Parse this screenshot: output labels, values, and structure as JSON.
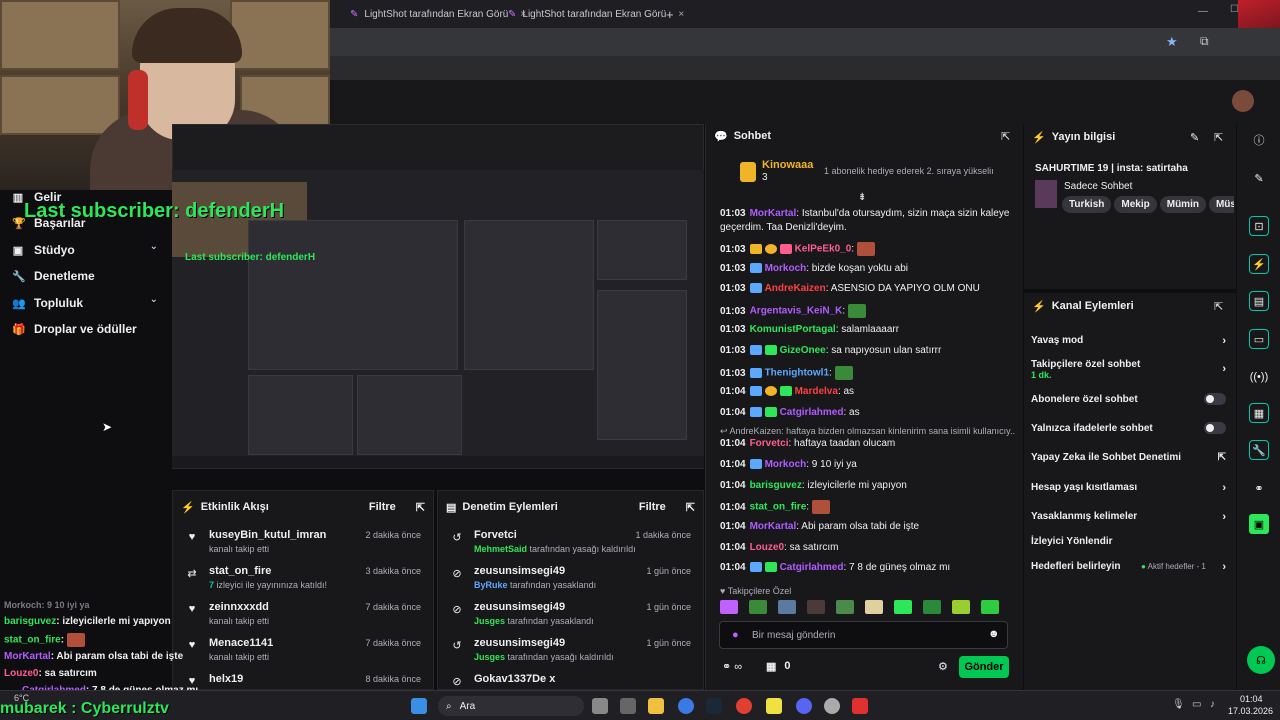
{
  "browser": {
    "tabs": [
      {
        "label": "LightShot tarafından Ekran Görü",
        "close": "×"
      },
      {
        "label": "LightShot tarafından Ekran Görü",
        "close": "×"
      }
    ],
    "new_tab": "+"
  },
  "overlay": {
    "subscriber_text": "Last subscriber: defenderH",
    "mini_subscriber_text": "Last subscriber: defenderH",
    "bottom_text": "mubarek : Cyberrulztv"
  },
  "nav": {
    "items": [
      {
        "label": "Gelir",
        "icon": "bar-chart-icon"
      },
      {
        "label": "Başarılar",
        "icon": "trophy-icon"
      },
      {
        "label": "Stüdyo",
        "icon": "video-icon",
        "chevron": "⌄"
      },
      {
        "label": "Denetleme",
        "icon": "wrench-icon"
      },
      {
        "label": "Topluluk",
        "icon": "people-icon",
        "chevron": "⌄"
      },
      {
        "label": "Droplar ve ödüller",
        "icon": "gift-icon"
      }
    ]
  },
  "activity": {
    "title": "Etkinlik Akışı",
    "filter": "Filtre",
    "rows": [
      {
        "name": "kuseyBin_kutul_imran",
        "sub": "kanalı takip etti",
        "time": "2 dakika önce",
        "icon": "heart-icon"
      },
      {
        "name": "stat_on_fire",
        "sub_hl": "7",
        "sub": " izleyici ile yayınınıza katıldı!",
        "time": "3 dakika önce",
        "icon": "raid-icon"
      },
      {
        "name": "zeinnxxxdd",
        "sub": "kanalı takip etti",
        "time": "7 dakika önce",
        "icon": "heart-icon"
      },
      {
        "name": "Menace1141",
        "sub": "kanalı takip etti",
        "time": "7 dakika önce",
        "icon": "heart-icon"
      },
      {
        "name": "helx19",
        "sub": "",
        "time": "8 dakika önce",
        "icon": "heart-icon"
      }
    ]
  },
  "moderation": {
    "title": "Denetim Eylemleri",
    "filter": "Filtre",
    "rows": [
      {
        "name": "Forvetci",
        "by": "MehmetSaid",
        "action": " tarafından yasağı kaldırıldı",
        "time": "1 dakika önce",
        "icon": "undo-icon"
      },
      {
        "name": "zeusunsimsegi49",
        "by": "ByRuke",
        "action": " tarafından yasaklandı",
        "time": "1 gün önce",
        "icon": "ban-icon"
      },
      {
        "name": "zeusunsimsegi49",
        "by": "Jusges",
        "action": " tarafından yasaklandı",
        "time": "1 gün önce",
        "icon": "ban-icon"
      },
      {
        "name": "zeusunsimsegi49",
        "by": "Jusges",
        "action": " tarafından yasağı kaldırıldı",
        "time": "1 gün önce",
        "icon": "undo-icon"
      },
      {
        "name": "Gokav1337De",
        "by": "",
        "action": "",
        "time": "",
        "icon": "ban-icon",
        "suffix": "x"
      }
    ]
  },
  "chat": {
    "title": "Sohbet",
    "pinned_user": "Kinowaaa",
    "pinned_count": "3",
    "pinned_msg": "1 abonelik hediye ederek 2. sıraya yükseliı",
    "messages": [
      {
        "t": "01:03",
        "u": "MorKartal",
        "c": "#b15cff",
        "m": ": İstanbul'da otursaydım, sizin maça sizin kaleye"
      },
      {
        "t": "",
        "u": "",
        "c": "#efeff1",
        "m": "geçerdim. Taa Denizli'deyim."
      },
      {
        "t": "01:03",
        "u": "KelPeEk0_0",
        "c": "#ff5d8f",
        "m": ":"
      },
      {
        "t": "01:03",
        "u": "Morkoch",
        "c": "#b15cff",
        "m": ": bizde koşan yoktu abi"
      },
      {
        "t": "01:03",
        "u": "AndreKaizen",
        "c": "#ff4040",
        "m": ": ASENSİO DA YAPIYO OLM ONU"
      },
      {
        "t": "01:03",
        "u": "Argentavis_KeiN_K",
        "c": "#b15cff",
        "m": ":"
      },
      {
        "t": "01:03",
        "u": "KomunistPortagal",
        "c": "#2ee65a",
        "m": ": salamlaaaarr"
      },
      {
        "t": "01:03",
        "u": "GizeOnee",
        "c": "#2ee65a",
        "m": ": sa napıyosun ulan satırrr"
      },
      {
        "t": "01:03",
        "u": "Thenightowl1",
        "c": "#5ca8ff",
        "m": ":"
      },
      {
        "t": "01:04",
        "u": "Mardelva",
        "c": "#ff4040",
        "m": ": as"
      },
      {
        "t": "01:04",
        "u": "Catgirlahmed",
        "c": "#b15cff",
        "m": ": as"
      },
      {
        "t": "",
        "u": "",
        "c": "#adadb8",
        "m": "↩ AndreKaizen: haftaya bizden olmazsan kinlenirim sana isimli kullanıcıy..."
      },
      {
        "t": "01:04",
        "u": "Forvetci",
        "c": "#ff5d8f",
        "m": ": haftaya taadan olucam"
      },
      {
        "t": "01:04",
        "u": "Morkoch",
        "c": "#b15cff",
        "m": ": 9 10 iyi ya"
      },
      {
        "t": "01:04",
        "u": "barisguvez",
        "c": "#2ee65a",
        "m": ": izleyicilerle mi yapıyon"
      },
      {
        "t": "01:04",
        "u": "stat_on_fire",
        "c": "#2ee65a",
        "m": ":"
      },
      {
        "t": "01:04",
        "u": "MorKartal",
        "c": "#b15cff",
        "m": ": Abi param olsa tabi de işte"
      },
      {
        "t": "01:04",
        "u": "Louze0",
        "c": "#ff5d8f",
        "m": ": sa satırcım"
      },
      {
        "t": "01:04",
        "u": "Catgirlahmed",
        "c": "#b15cff",
        "m": ": 7 8 de güneş olmaz mı"
      }
    ],
    "follower_label": "Takipçilere Özel",
    "input_placeholder": "Bir mesaj gönderin",
    "points": "0",
    "send": "Gönder"
  },
  "stream_info": {
    "title": "Yayın bilgisi",
    "stream_title": "SAHURTIME 19 | insta: satirtaha",
    "category": "Sadece Sohbet",
    "tags": [
      "Turkish",
      "Mekip",
      "Mümin",
      "Müs"
    ]
  },
  "channel_actions": {
    "title": "Kanal Eylemleri",
    "items": [
      {
        "label": "Yavaş mod",
        "type": "arrow"
      },
      {
        "label": "Takipçilere özel sohbet",
        "sub": "1 dk.",
        "type": "arrow"
      },
      {
        "label": "Abonelere özel sohbet",
        "type": "toggle"
      },
      {
        "label": "Yalnızca ifadelerle sohbet",
        "type": "toggle"
      },
      {
        "label": "Yapay Zeka ile Sohbet Denetimi",
        "type": "ext"
      },
      {
        "label": "Hesap yaşı kısıtlaması",
        "type": "arrow"
      },
      {
        "label": "Yasaklanmış kelimeler",
        "type": "arrow"
      },
      {
        "label": "İzleyici Yönlendir",
        "type": "none"
      },
      {
        "label": "Hedefleri belirleyin",
        "status": "Aktif hedefler - 1",
        "type": "arrow"
      }
    ]
  },
  "overlay_chat": [
    {
      "u": "Morkoch",
      "c": "#7a7a85",
      "m": ": 9 10 iyi ya"
    },
    {
      "u": "barisguvez",
      "c": "#2ee65a",
      "m": ": izleyicilerle mi yapıyon"
    },
    {
      "u": "stat_on_fire",
      "c": "#2ee65a",
      "m": ":"
    },
    {
      "u": "MorKartal",
      "c": "#b15cff",
      "m": ": Abi param olsa tabi de işte"
    },
    {
      "u": "Louze0",
      "c": "#ff5d8f",
      "m": ": sa satırcım"
    },
    {
      "u": "Catgirlahmed",
      "c": "#b15cff",
      "m": ": 7 8 de güneş olmaz mı"
    }
  ],
  "taskbar": {
    "search": "Ara",
    "time": "01:04",
    "date": "17.03.2026",
    "weather": "6°C"
  },
  "colors": {
    "accent": "#00c853",
    "twitch_purple": "#9147ff",
    "sub_green": "#2ee65a"
  }
}
